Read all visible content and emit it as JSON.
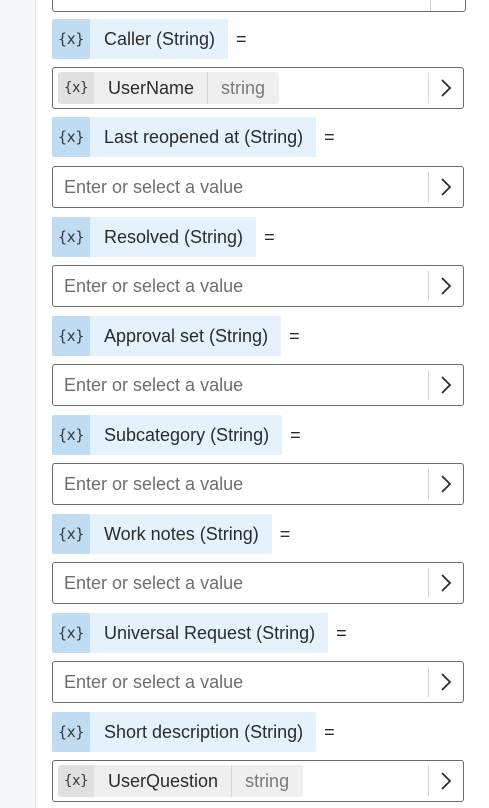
{
  "var_icon_glyph": "{x}",
  "equals_sign": "=",
  "placeholder": "Enter or select a value",
  "parameters": [
    {
      "label": "Caller (String)",
      "token": {
        "name": "UserName",
        "type": "string"
      }
    },
    {
      "label": "Last reopened at (String)"
    },
    {
      "label": "Resolved (String)"
    },
    {
      "label": "Approval set (String)"
    },
    {
      "label": "Subcategory (String)"
    },
    {
      "label": "Work notes (String)"
    },
    {
      "label": "Universal Request (String)"
    },
    {
      "label": "Short description (String)",
      "token": {
        "name": "UserQuestion",
        "type": "string"
      }
    }
  ]
}
